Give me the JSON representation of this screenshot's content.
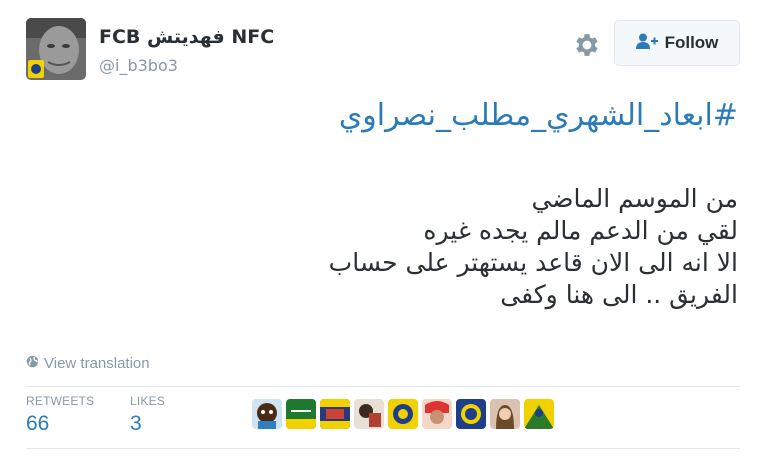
{
  "user": {
    "display_name": "FCB فهديتش NFC",
    "handle": "@i_b3bo3",
    "avatar_icon": "user-avatar"
  },
  "actions": {
    "settings_icon": "gear-icon",
    "follow_label": "Follow",
    "follow_icon": "add-user-icon"
  },
  "tweet": {
    "hashtag": "#ابعاد_الشهري_مطلب_نصراوي",
    "lines": [
      "من الموسم الماضي",
      "لقي من الدعم  مالم يجده غيره",
      "الا انه الى الان قاعد يستهتر على حساب",
      "الفريق .. الى هنا وكفى"
    ],
    "translate_label": "View translation",
    "translate_icon": "globe-icon"
  },
  "stats": {
    "retweets_label": "RETWEETS",
    "retweets_value": "66",
    "likes_label": "LIKES",
    "likes_value": "3"
  },
  "colors": {
    "link": "#2b7bb9",
    "muted": "#8899a6",
    "text": "#292f33",
    "border": "#e1e8ed"
  }
}
